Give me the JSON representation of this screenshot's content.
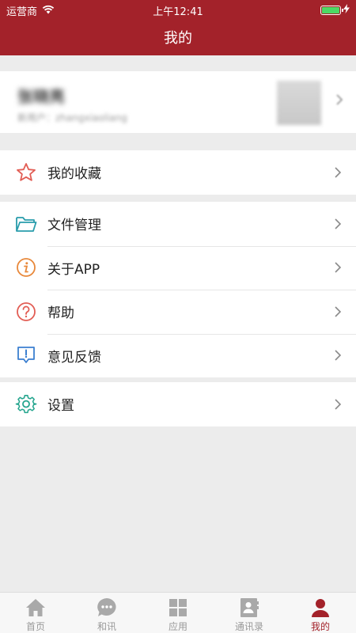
{
  "status_bar": {
    "carrier": "运营商",
    "time": "上午12:41",
    "battery_percent": 100
  },
  "header": {
    "title": "我的"
  },
  "profile": {
    "name": "张晓亮",
    "subtitle": "新用户：zhangxiaoliang"
  },
  "menu": {
    "favorites": "我的收藏",
    "file_manager": "文件管理",
    "about": "关于APP",
    "help": "帮助",
    "feedback": "意见反馈",
    "settings": "设置"
  },
  "tabs": [
    {
      "label": "首页",
      "icon": "home-icon"
    },
    {
      "label": "和讯",
      "icon": "chat-icon"
    },
    {
      "label": "应用",
      "icon": "apps-grid-icon"
    },
    {
      "label": "通讯录",
      "icon": "contacts-icon"
    },
    {
      "label": "我的",
      "icon": "person-icon",
      "active": true
    }
  ],
  "colors": {
    "brand": "#a3222a",
    "background": "#ececec",
    "inactive": "#999999"
  }
}
